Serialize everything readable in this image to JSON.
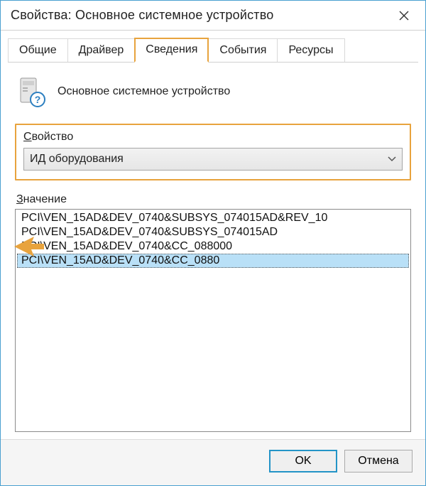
{
  "window": {
    "title": "Свойства: Основное системное устройство"
  },
  "tabs": [
    {
      "label": "Общие"
    },
    {
      "label": "Драйвер"
    },
    {
      "label": "Сведения"
    },
    {
      "label": "События"
    },
    {
      "label": "Ресурсы"
    }
  ],
  "active_tab_index": 2,
  "device": {
    "name": "Основное системное устройство"
  },
  "property": {
    "label_prefix": "С",
    "label_rest": "войство",
    "selected": "ИД оборудования"
  },
  "value": {
    "label_prefix": "З",
    "label_rest": "начение",
    "items": [
      "PCI\\VEN_15AD&DEV_0740&SUBSYS_074015AD&REV_10",
      "PCI\\VEN_15AD&DEV_0740&SUBSYS_074015AD",
      "PCI\\VEN_15AD&DEV_0740&CC_088000",
      "PCI\\VEN_15AD&DEV_0740&CC_0880"
    ],
    "selected_index": 3
  },
  "buttons": {
    "ok": "OK",
    "cancel": "Отмена"
  }
}
